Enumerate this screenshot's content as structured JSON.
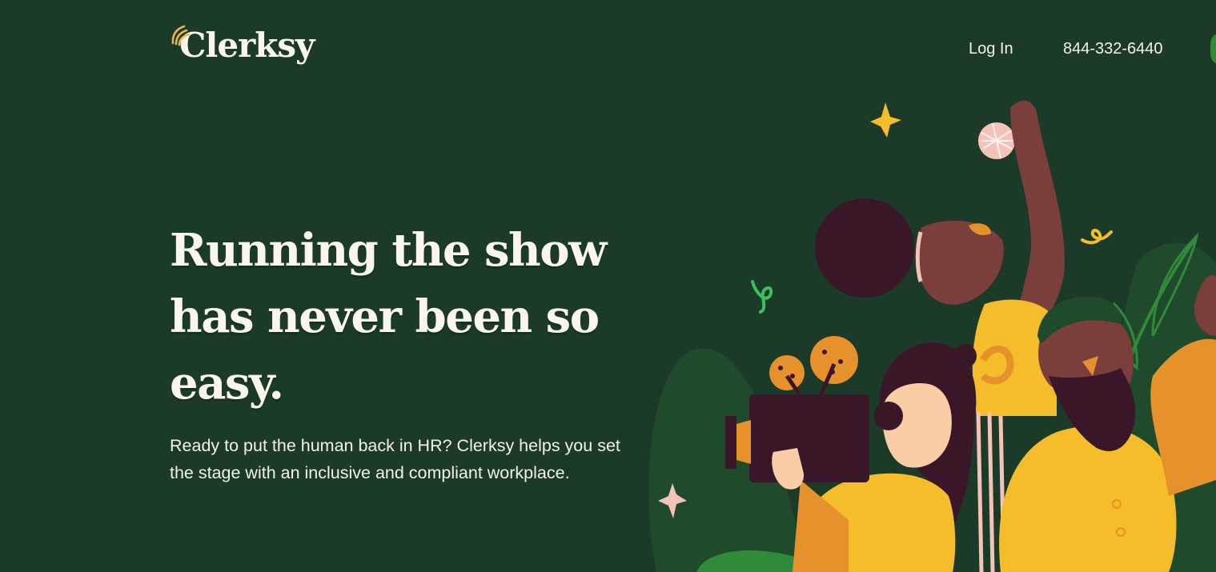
{
  "header": {
    "brand_name": "Clerksy",
    "login_label": "Log In",
    "phone": "844-332-6440"
  },
  "hero": {
    "title_lines": [
      "Running the show",
      "has never been so",
      "easy."
    ],
    "subtitle": "Ready to put the human back in HR? Clerksy helps you set the stage with an inclusive and compliant workplace."
  },
  "icons": {
    "logo_mark": "clerksy-logo-mark-icon",
    "hero": "hero-illustration"
  },
  "colors": {
    "background": "#1b3a27",
    "text": "#fbf6ec",
    "accent_yellow": "#f6bd2b",
    "accent_orange": "#e6912b",
    "accent_green": "#2f8a3a",
    "dark_plum": "#3a1728"
  }
}
